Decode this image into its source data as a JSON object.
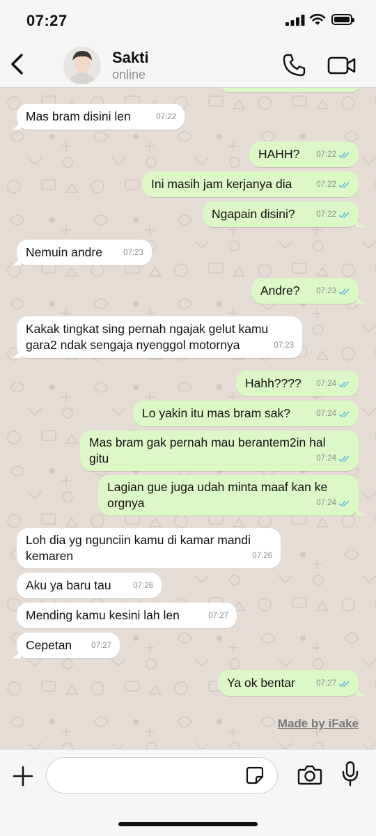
{
  "status_bar": {
    "time": "07:27"
  },
  "header": {
    "name": "Sakti",
    "status": "online"
  },
  "messages": [
    {
      "text": "Mas bram disini len",
      "time": "07:22",
      "dir": "in"
    },
    {
      "text": "HAHH?",
      "time": "07:22",
      "dir": "out"
    },
    {
      "text": "Ini masih jam kerjanya dia",
      "time": "07:22",
      "dir": "out"
    },
    {
      "text": "Ngapain disini?",
      "time": "07:22",
      "dir": "out"
    },
    {
      "text": "Nemuin andre",
      "time": "07:23",
      "dir": "in"
    },
    {
      "text": "Andre?",
      "time": "07:23",
      "dir": "out"
    },
    {
      "text": "Kakak tingkat sing pernah ngajak gelut kamu gara2 ndak sengaja nyenggol motornya",
      "line1": "Kakak tingkat sing pernah ngajak gelut kamu",
      "line2": "gara2 ndak sengaja nyenggol motornya",
      "time": "07:23",
      "dir": "in"
    },
    {
      "text": "Hahh????",
      "time": "07:24",
      "dir": "out"
    },
    {
      "text": "Lo yakin itu mas bram sak?",
      "time": "07:24",
      "dir": "out"
    },
    {
      "text": "Mas bram gak pernah mau berantem2in hal gitu",
      "line1": "Mas bram gak pernah mau berantem2in hal",
      "line2": "gitu",
      "time": "07:24",
      "dir": "out"
    },
    {
      "text": "Lagian gue juga udah minta maaf kan ke orgnya",
      "line1": "Lagian gue juga udah minta maaf kan ke",
      "line2": "orgnya",
      "time": "07:24",
      "dir": "out"
    },
    {
      "text": "Loh dia yg ngunciin kamu di kamar mandi kemaren",
      "line1": "Loh dia yg ngunciin kamu di kamar mandi",
      "line2": "kemaren",
      "time": "07:26",
      "dir": "in"
    },
    {
      "text": "Aku ya baru tau",
      "time": "07:26",
      "dir": "in"
    },
    {
      "text": "Mending kamu kesini lah len",
      "time": "07:27",
      "dir": "in"
    },
    {
      "text": "Cepetan",
      "time": "07:27",
      "dir": "in"
    },
    {
      "text": "Ya ok bentar",
      "time": "07:27",
      "dir": "out"
    }
  ],
  "watermark": "Made by iFake",
  "input": {
    "placeholder": ""
  },
  "icons": {
    "back": "chevron-left-icon",
    "call": "phone-icon",
    "video": "video-camera-icon",
    "plus": "plus-icon",
    "sticker": "sticker-icon",
    "camera": "camera-icon",
    "mic": "microphone-icon",
    "read_receipt": "double-check-icon"
  },
  "colors": {
    "incoming_bubble": "#ffffff",
    "outgoing_bubble": "#dcf8c6",
    "chat_background": "#e5ddd5",
    "read_tick": "#4fb6ec"
  }
}
